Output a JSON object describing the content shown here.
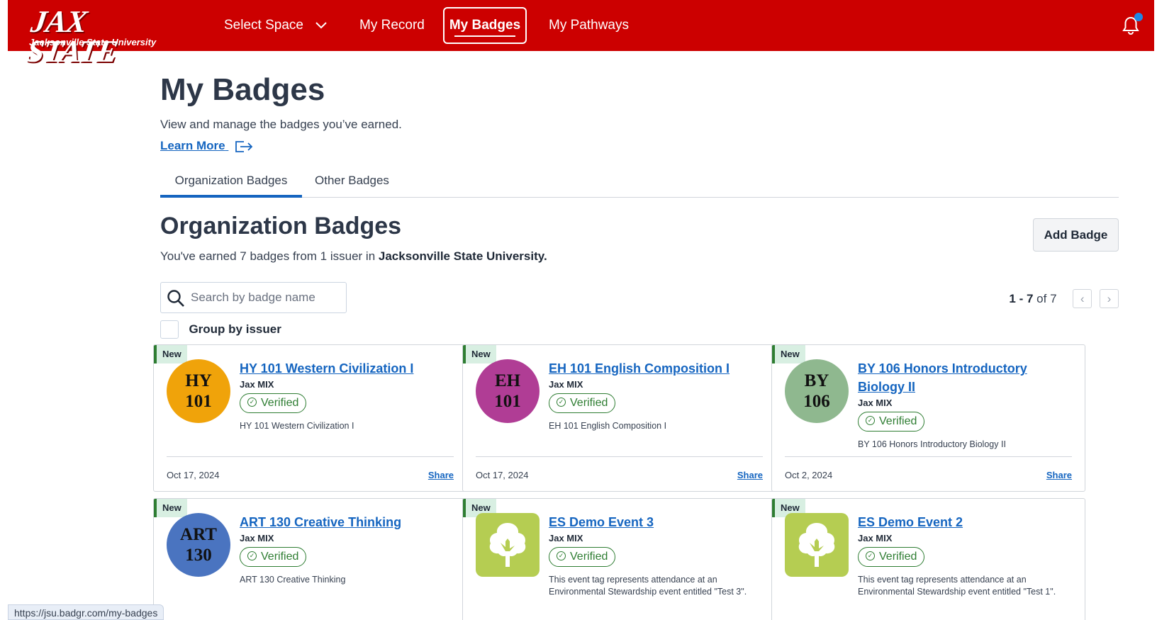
{
  "nav": {
    "logo_main": "JAX STATE",
    "logo_sub": "Jacksonville State University",
    "select_space": "Select Space",
    "my_record": "My Record",
    "my_badges": "My Badges",
    "my_pathways": "My Pathways"
  },
  "page": {
    "title": "My Badges",
    "description": "View and manage the badges you’ve earned.",
    "learn_more": "Learn More"
  },
  "tabs": {
    "org": "Organization Badges",
    "other": "Other Badges"
  },
  "section": {
    "title": "Organization Badges",
    "add_badge": "Add Badge",
    "earned_prefix": "You've earned 7 badges from 1 issuer in ",
    "earned_org": "Jacksonville State University."
  },
  "search": {
    "placeholder": "Search by badge name"
  },
  "pager": {
    "range": "1 - 7",
    "of": "of 7"
  },
  "group_by": "Group by issuer",
  "cards": [
    {
      "new": "New",
      "line1": "HY",
      "line2": "101",
      "color": "#f0a30a",
      "title": "HY 101 Western Civilization I",
      "issuer": "Jax MIX",
      "verified": "Verified",
      "desc": "HY 101 Western Civilization I",
      "date": "Oct 17, 2024",
      "share": "Share"
    },
    {
      "new": "New",
      "line1": "EH",
      "line2": "101",
      "color": "#b03d95",
      "title": "EH 101 English Composition I",
      "issuer": "Jax MIX",
      "verified": "Verified",
      "desc": "EH 101 English Composition I",
      "date": "Oct 17, 2024",
      "share": "Share"
    },
    {
      "new": "New",
      "line1": "BY",
      "line2": "106",
      "color": "#8fb88f",
      "title": "BY 106 Honors Introductory Biology II",
      "issuer": "Jax MIX",
      "verified": "Verified",
      "desc": "BY 106 Honors Introductory Biology II",
      "date": "Oct 2, 2024",
      "share": "Share"
    },
    {
      "new": "New",
      "line1": "ART",
      "line2": "130",
      "color": "#4a74c0",
      "title": "ART 130 Creative Thinking",
      "issuer": "Jax MIX",
      "verified": "Verified",
      "desc": "ART 130 Creative Thinking"
    },
    {
      "new": "New",
      "tree_color": "#b5cd52",
      "title": "ES Demo Event 3",
      "issuer": "Jax MIX",
      "verified": "Verified",
      "desc": "This event tag represents attendance at an Environmental Stewardship event entitled \"Test 3\"."
    },
    {
      "new": "New",
      "tree_color": "#b5cd52",
      "title": "ES Demo Event 2",
      "issuer": "Jax MIX",
      "verified": "Verified",
      "desc": "This event tag represents attendance at an Environmental Stewardship event entitled \"Test 1\"."
    }
  ],
  "status_url": "https://jsu.badgr.com/my-badges",
  "icons": [
    "chevron-down-icon",
    "bell-icon",
    "external-link-icon",
    "search-icon",
    "chevron-left-icon",
    "chevron-right-icon",
    "verified-check-icon",
    "tree-icon"
  ]
}
